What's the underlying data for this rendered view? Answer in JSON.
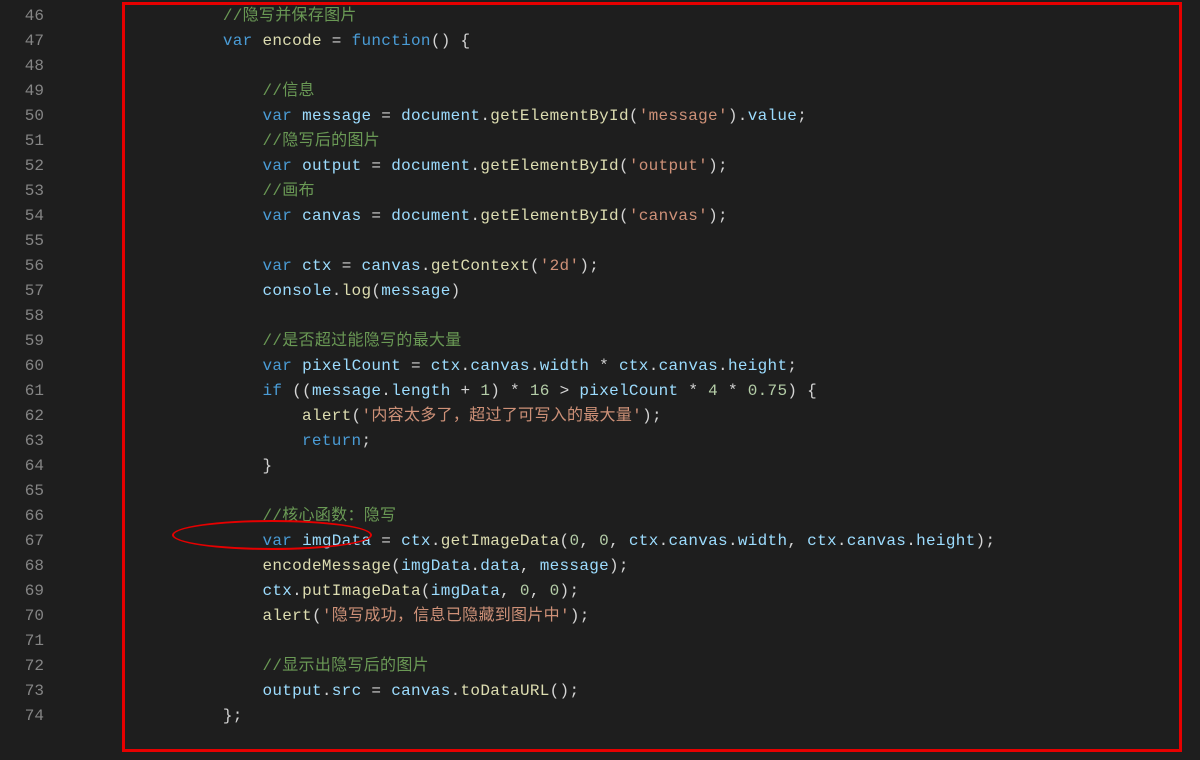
{
  "first_line_number": 46,
  "code": {
    "lines": [
      [
        [
          "ind",
          "            "
        ],
        [
          "cm",
          "//隐写并保存图片"
        ]
      ],
      [
        [
          "ind",
          "            "
        ],
        [
          "kw",
          "var"
        ],
        [
          "pl",
          " "
        ],
        [
          "fn",
          "encode"
        ],
        [
          "pl",
          " "
        ],
        [
          "op",
          "="
        ],
        [
          "pl",
          " "
        ],
        [
          "kw",
          "function"
        ],
        [
          "op",
          "()"
        ],
        [
          "pl",
          " "
        ],
        [
          "op",
          "{"
        ]
      ],
      [
        [
          "pl",
          ""
        ]
      ],
      [
        [
          "ind",
          "                "
        ],
        [
          "cm",
          "//信息"
        ]
      ],
      [
        [
          "ind",
          "                "
        ],
        [
          "kw",
          "var"
        ],
        [
          "pl",
          " "
        ],
        [
          "id",
          "message"
        ],
        [
          "pl",
          " "
        ],
        [
          "op",
          "="
        ],
        [
          "pl",
          " "
        ],
        [
          "id",
          "document"
        ],
        [
          "op",
          "."
        ],
        [
          "fn",
          "getElementById"
        ],
        [
          "op",
          "("
        ],
        [
          "str",
          "'message'"
        ],
        [
          "op",
          ")."
        ],
        [
          "id",
          "value"
        ],
        [
          "op",
          ";"
        ]
      ],
      [
        [
          "ind",
          "                "
        ],
        [
          "cm",
          "//隐写后的图片"
        ]
      ],
      [
        [
          "ind",
          "                "
        ],
        [
          "kw",
          "var"
        ],
        [
          "pl",
          " "
        ],
        [
          "id",
          "output"
        ],
        [
          "pl",
          " "
        ],
        [
          "op",
          "="
        ],
        [
          "pl",
          " "
        ],
        [
          "id",
          "document"
        ],
        [
          "op",
          "."
        ],
        [
          "fn",
          "getElementById"
        ],
        [
          "op",
          "("
        ],
        [
          "str",
          "'output'"
        ],
        [
          "op",
          ");"
        ]
      ],
      [
        [
          "ind",
          "                "
        ],
        [
          "cm",
          "//画布"
        ]
      ],
      [
        [
          "ind",
          "                "
        ],
        [
          "kw",
          "var"
        ],
        [
          "pl",
          " "
        ],
        [
          "id",
          "canvas"
        ],
        [
          "pl",
          " "
        ],
        [
          "op",
          "="
        ],
        [
          "pl",
          " "
        ],
        [
          "id",
          "document"
        ],
        [
          "op",
          "."
        ],
        [
          "fn",
          "getElementById"
        ],
        [
          "op",
          "("
        ],
        [
          "str",
          "'canvas'"
        ],
        [
          "op",
          ");"
        ]
      ],
      [
        [
          "pl",
          ""
        ]
      ],
      [
        [
          "ind",
          "                "
        ],
        [
          "kw",
          "var"
        ],
        [
          "pl",
          " "
        ],
        [
          "id",
          "ctx"
        ],
        [
          "pl",
          " "
        ],
        [
          "op",
          "="
        ],
        [
          "pl",
          " "
        ],
        [
          "id",
          "canvas"
        ],
        [
          "op",
          "."
        ],
        [
          "fn",
          "getContext"
        ],
        [
          "op",
          "("
        ],
        [
          "str",
          "'2d'"
        ],
        [
          "op",
          ");"
        ]
      ],
      [
        [
          "ind",
          "                "
        ],
        [
          "id",
          "console"
        ],
        [
          "op",
          "."
        ],
        [
          "fn",
          "log"
        ],
        [
          "op",
          "("
        ],
        [
          "id",
          "message"
        ],
        [
          "op",
          ")"
        ]
      ],
      [
        [
          "pl",
          ""
        ]
      ],
      [
        [
          "ind",
          "                "
        ],
        [
          "cm",
          "//是否超过能隐写的最大量"
        ]
      ],
      [
        [
          "ind",
          "                "
        ],
        [
          "kw",
          "var"
        ],
        [
          "pl",
          " "
        ],
        [
          "id",
          "pixelCount"
        ],
        [
          "pl",
          " "
        ],
        [
          "op",
          "="
        ],
        [
          "pl",
          " "
        ],
        [
          "id",
          "ctx"
        ],
        [
          "op",
          "."
        ],
        [
          "id",
          "canvas"
        ],
        [
          "op",
          "."
        ],
        [
          "id",
          "width"
        ],
        [
          "pl",
          " "
        ],
        [
          "op",
          "*"
        ],
        [
          "pl",
          " "
        ],
        [
          "id",
          "ctx"
        ],
        [
          "op",
          "."
        ],
        [
          "id",
          "canvas"
        ],
        [
          "op",
          "."
        ],
        [
          "id",
          "height"
        ],
        [
          "op",
          ";"
        ]
      ],
      [
        [
          "ind",
          "                "
        ],
        [
          "kw",
          "if"
        ],
        [
          "pl",
          " "
        ],
        [
          "op",
          "(("
        ],
        [
          "id",
          "message"
        ],
        [
          "op",
          "."
        ],
        [
          "id",
          "length"
        ],
        [
          "pl",
          " "
        ],
        [
          "op",
          "+"
        ],
        [
          "pl",
          " "
        ],
        [
          "num",
          "1"
        ],
        [
          "op",
          ")"
        ],
        [
          "pl",
          " "
        ],
        [
          "op",
          "*"
        ],
        [
          "pl",
          " "
        ],
        [
          "num",
          "16"
        ],
        [
          "pl",
          " "
        ],
        [
          "op",
          ">"
        ],
        [
          "pl",
          " "
        ],
        [
          "id",
          "pixelCount"
        ],
        [
          "pl",
          " "
        ],
        [
          "op",
          "*"
        ],
        [
          "pl",
          " "
        ],
        [
          "num",
          "4"
        ],
        [
          "pl",
          " "
        ],
        [
          "op",
          "*"
        ],
        [
          "pl",
          " "
        ],
        [
          "num",
          "0.75"
        ],
        [
          "op",
          ")"
        ],
        [
          "pl",
          " "
        ],
        [
          "op",
          "{"
        ]
      ],
      [
        [
          "ind",
          "                    "
        ],
        [
          "fn",
          "alert"
        ],
        [
          "op",
          "("
        ],
        [
          "str",
          "'内容太多了，超过了可写入的最大量'"
        ],
        [
          "op",
          ");"
        ]
      ],
      [
        [
          "ind",
          "                    "
        ],
        [
          "kw",
          "return"
        ],
        [
          "op",
          ";"
        ]
      ],
      [
        [
          "ind",
          "                "
        ],
        [
          "op",
          "}"
        ]
      ],
      [
        [
          "pl",
          ""
        ]
      ],
      [
        [
          "ind",
          "                "
        ],
        [
          "cm",
          "//核心函数：隐写"
        ]
      ],
      [
        [
          "ind",
          "                "
        ],
        [
          "kw",
          "var"
        ],
        [
          "pl",
          " "
        ],
        [
          "id",
          "imgData"
        ],
        [
          "pl",
          " "
        ],
        [
          "op",
          "="
        ],
        [
          "pl",
          " "
        ],
        [
          "id",
          "ctx"
        ],
        [
          "op",
          "."
        ],
        [
          "fn",
          "getImageData"
        ],
        [
          "op",
          "("
        ],
        [
          "num",
          "0"
        ],
        [
          "op",
          ","
        ],
        [
          "pl",
          " "
        ],
        [
          "num",
          "0"
        ],
        [
          "op",
          ","
        ],
        [
          "pl",
          " "
        ],
        [
          "id",
          "ctx"
        ],
        [
          "op",
          "."
        ],
        [
          "id",
          "canvas"
        ],
        [
          "op",
          "."
        ],
        [
          "id",
          "width"
        ],
        [
          "op",
          ","
        ],
        [
          "pl",
          " "
        ],
        [
          "id",
          "ctx"
        ],
        [
          "op",
          "."
        ],
        [
          "id",
          "canvas"
        ],
        [
          "op",
          "."
        ],
        [
          "id",
          "height"
        ],
        [
          "op",
          ");"
        ]
      ],
      [
        [
          "ind",
          "                "
        ],
        [
          "fn",
          "encodeMessage"
        ],
        [
          "op",
          "("
        ],
        [
          "id",
          "imgData"
        ],
        [
          "op",
          "."
        ],
        [
          "id",
          "data"
        ],
        [
          "op",
          ","
        ],
        [
          "pl",
          " "
        ],
        [
          "id",
          "message"
        ],
        [
          "op",
          ");"
        ]
      ],
      [
        [
          "ind",
          "                "
        ],
        [
          "id",
          "ctx"
        ],
        [
          "op",
          "."
        ],
        [
          "fn",
          "putImageData"
        ],
        [
          "op",
          "("
        ],
        [
          "id",
          "imgData"
        ],
        [
          "op",
          ","
        ],
        [
          "pl",
          " "
        ],
        [
          "num",
          "0"
        ],
        [
          "op",
          ","
        ],
        [
          "pl",
          " "
        ],
        [
          "num",
          "0"
        ],
        [
          "op",
          ");"
        ]
      ],
      [
        [
          "ind",
          "                "
        ],
        [
          "fn",
          "alert"
        ],
        [
          "op",
          "("
        ],
        [
          "str",
          "'隐写成功，信息已隐藏到图片中'"
        ],
        [
          "op",
          ");"
        ]
      ],
      [
        [
          "pl",
          ""
        ]
      ],
      [
        [
          "ind",
          "                "
        ],
        [
          "cm",
          "//显示出隐写后的图片"
        ]
      ],
      [
        [
          "ind",
          "                "
        ],
        [
          "id",
          "output"
        ],
        [
          "op",
          "."
        ],
        [
          "id",
          "src"
        ],
        [
          "pl",
          " "
        ],
        [
          "op",
          "="
        ],
        [
          "pl",
          " "
        ],
        [
          "id",
          "canvas"
        ],
        [
          "op",
          "."
        ],
        [
          "fn",
          "toDataURL"
        ],
        [
          "op",
          "();"
        ]
      ],
      [
        [
          "ind",
          "            "
        ],
        [
          "op",
          "};"
        ]
      ]
    ]
  }
}
